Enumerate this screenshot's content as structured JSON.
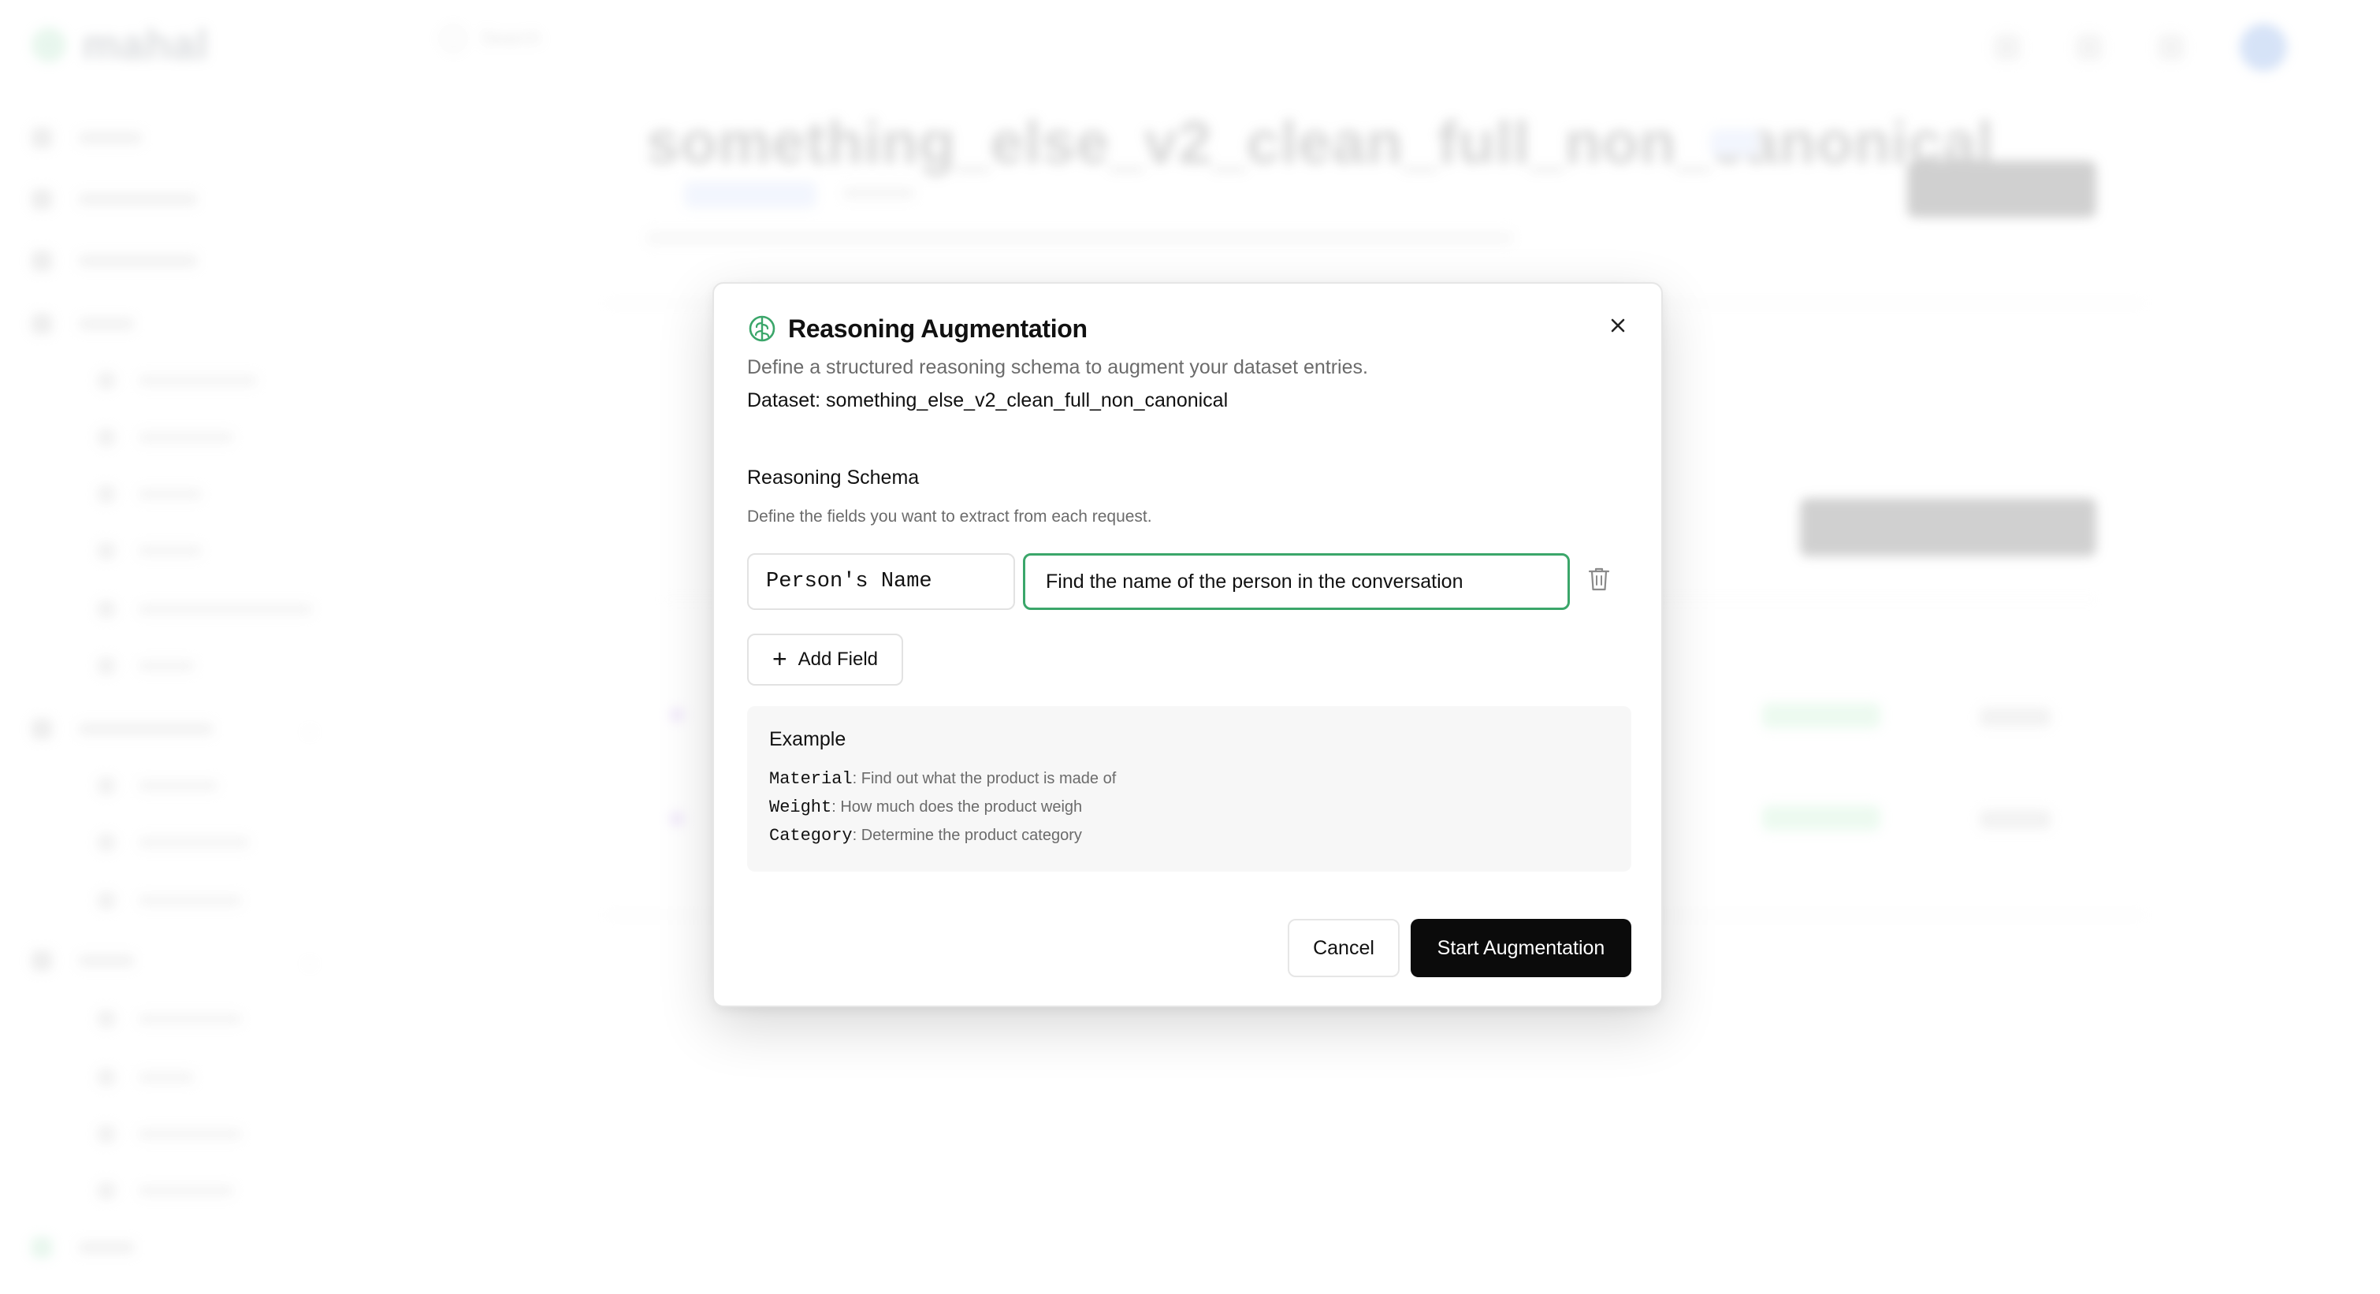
{
  "background": {
    "logo_text": "mahal",
    "search_placeholder": "Search",
    "page_title": "something_else_v2_clean_full_non_canonical"
  },
  "modal": {
    "title": "Reasoning Augmentation",
    "description": "Define a structured reasoning schema to augment your dataset entries.",
    "dataset_label": "Dataset: something_else_v2_clean_full_non_canonical",
    "schema_heading": "Reasoning Schema",
    "schema_description": "Define the fields you want to extract from each request.",
    "fields": [
      {
        "name": "Person's Name",
        "description": "Find the name of the person in the conversation"
      }
    ],
    "add_field_label": "Add Field",
    "example": {
      "title": "Example",
      "items": [
        {
          "key": "Material",
          "text": ": Find out what the product is made of"
        },
        {
          "key": "Weight",
          "text": ": How much does the product weigh"
        },
        {
          "key": "Category",
          "text": ": Determine the product category"
        }
      ]
    },
    "cancel_label": "Cancel",
    "start_label": "Start Augmentation"
  },
  "colors": {
    "accent_green": "#3ba66a",
    "primary_button": "#0b0b0b"
  },
  "icons": [
    "brain-icon",
    "close-icon",
    "trash-icon",
    "plus-icon"
  ]
}
